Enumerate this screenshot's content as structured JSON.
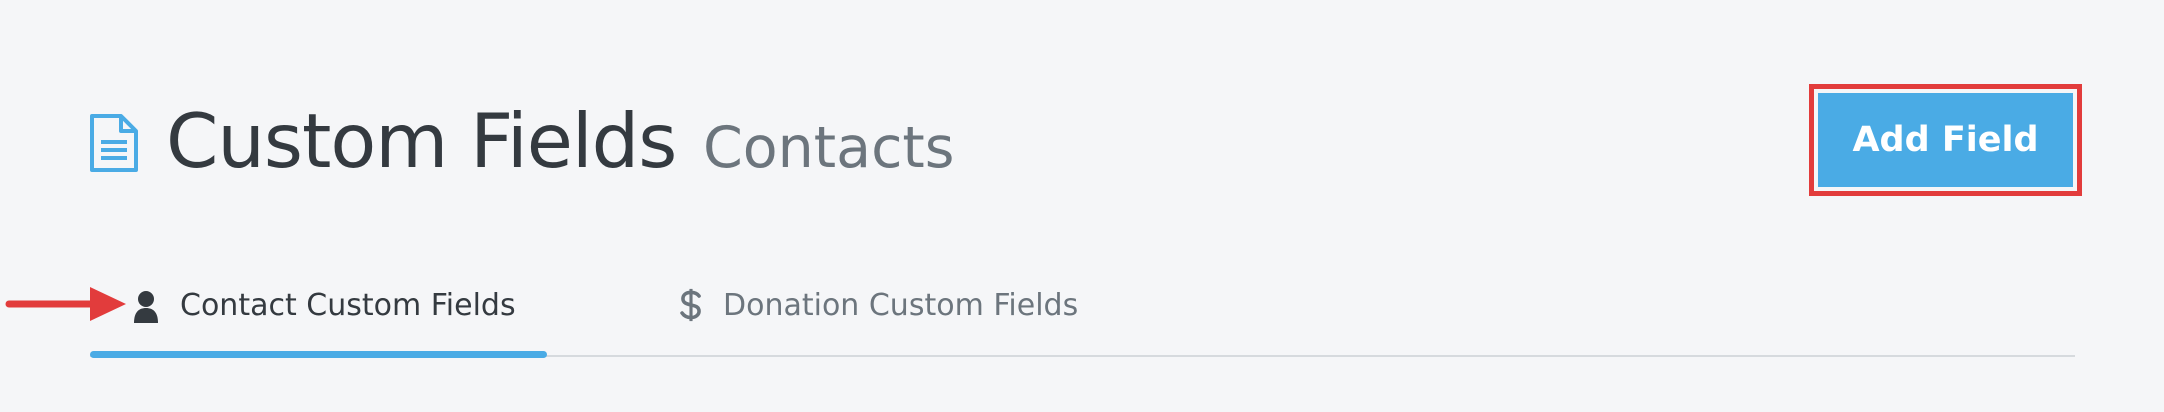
{
  "header": {
    "title": "Custom Fields",
    "subtitle": "Contacts",
    "title_icon": "document-icon",
    "add_button_label": "Add Field"
  },
  "tabs": [
    {
      "label": "Contact Custom Fields",
      "icon": "user-icon",
      "active": true
    },
    {
      "label": "Donation Custom Fields",
      "icon": "dollar-icon",
      "active": false
    }
  ],
  "colors": {
    "accent": "#4aabe5",
    "annotation_red": "#e23c3c",
    "title_text": "#343a40",
    "muted_text": "#6c757d",
    "background": "#f5f6f8"
  }
}
